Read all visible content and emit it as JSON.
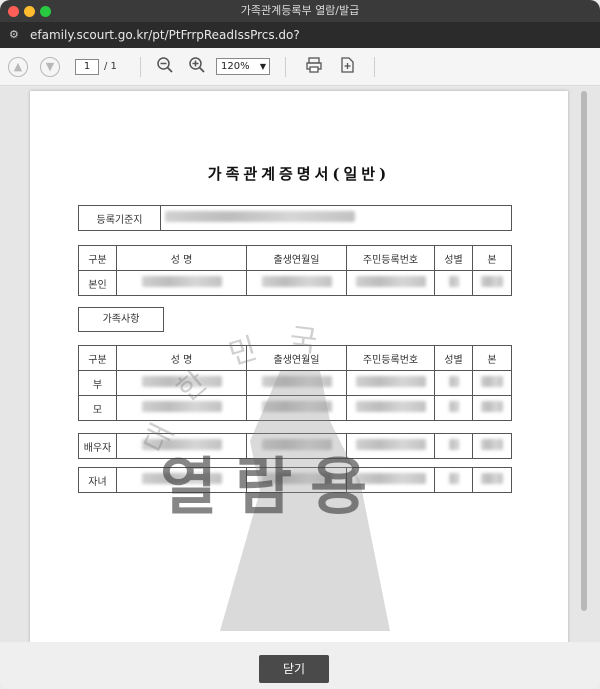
{
  "window": {
    "title": "가족관계등록부 열람/발급"
  },
  "address_bar": {
    "url": "efamily.scourt.go.kr/pt/PtFrrpReadIssPrcs.do?",
    "icon": "site-settings-icon"
  },
  "toolbar": {
    "page_current": "1",
    "page_total": "/ 1",
    "zoom": "120%",
    "icons": [
      "prev-page-icon",
      "next-page-icon",
      "zoom-out-icon",
      "zoom-in-icon",
      "print-icon",
      "save-icon"
    ]
  },
  "document": {
    "title": "가족관계증명서(일반)",
    "registration_label": "등록기준지",
    "columns": {
      "category": "구분",
      "name": "성 명",
      "birth": "출생연월일",
      "resident_no": "주민등록번호",
      "sex": "성별",
      "origin": "본"
    },
    "self_label": "본인",
    "family_section_label": "가족사항",
    "family_rows": [
      "부",
      "모"
    ],
    "spouse_label": "배우자",
    "child_label": "자녀",
    "watermark": "열람용",
    "seal_text": "대한민국"
  },
  "footer": {
    "close_label": "닫기"
  }
}
